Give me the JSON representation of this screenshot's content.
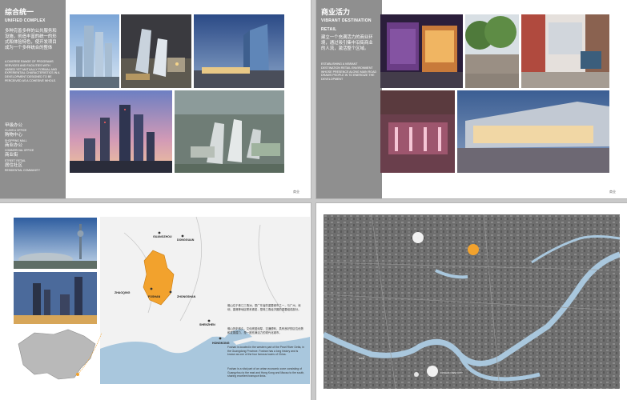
{
  "page1": {
    "title_cn": "综合统一",
    "title_en": "UNIFIED COMPLEX",
    "desc_cn": "多种完善多样的公共服务和设施，创造丰富的统一的形式和体验特色，使开发项目成为一个多样统合的整体",
    "desc_en": "A DIVERSE RANGE OF PROGRAMS SERVICES AND FACILITIES WITH VARIED YET MUTUALLY FORMAL AND EXPERIENTIAL CHARACTERISTICS IN A DEVELOPMENT DESIGNED TO BE PERCEIVED AS A COHESIVE WHOLE.",
    "list": [
      {
        "cn": "甲级办公",
        "en": "CLASS A OFFICE"
      },
      {
        "cn": "购物中心",
        "en": "SHOPPING MALL"
      },
      {
        "cn": "商业办公",
        "en": "COMMERCIAL OFFICE"
      },
      {
        "cn": "商业街",
        "en": "STREET RETAIL"
      },
      {
        "cn": "居住社区",
        "en": "RESIDENTIAL COMMUNITY"
      }
    ],
    "folio": "商业"
  },
  "page2": {
    "title_cn": "商业活力",
    "title_en": "VIBRANT DESTINATION RETAIL",
    "desc_cn": "建立一个充满活力的商业环境，通过吸引集中沿街商业的人流，激活整个区域。",
    "desc_en": "ESTABLISHING A VIBRANT DESTINATION RETAIL ENVIRONMENT WHOSE PRESENCE ALONG MAIN ROAD DRAWS PEOPLE IN TO ENERGIZE THE DEVELOPMENT",
    "folio": "商业"
  },
  "page3": {
    "cities": [
      "GUANGZHOU",
      "DONGGUAN",
      "ZHAOQING",
      "FOSHAN",
      "ZHONGSHAN",
      "SHENZHEN",
      "HONGKONG"
    ],
    "para_cn_1": "佛山位于珠江三角洲，是广东省的重要城市之一，与广州、深圳、香港等地区联系紧密，是珠三角经济圈的重要组成部分。",
    "para_cn_2": "佛山历史悠久，文化底蕴深厚，交通便利，具有良好的区位优势和发展潜力，是一座充满活力的现代化城市。",
    "para_en_1": "Foshan is located in the western part of the Pearl River Delta, in the Guangdong Province. Foshan has a long history and is known as one of the four famous towns of China.",
    "para_en_2": "Foshan is a vital part of an urban economic zone consisting of Guangzhou to the east and Hong Kong and Macau to the south, sharing excellent transport links."
  },
  "page4": {
    "marker_labels": [
      "SITE",
      "FOSHAN NEW CITY",
      "MARKER"
    ]
  },
  "colors": {
    "band": "#8f8f8f",
    "accent": "#f2a22d",
    "water": "#a9c7dd"
  }
}
